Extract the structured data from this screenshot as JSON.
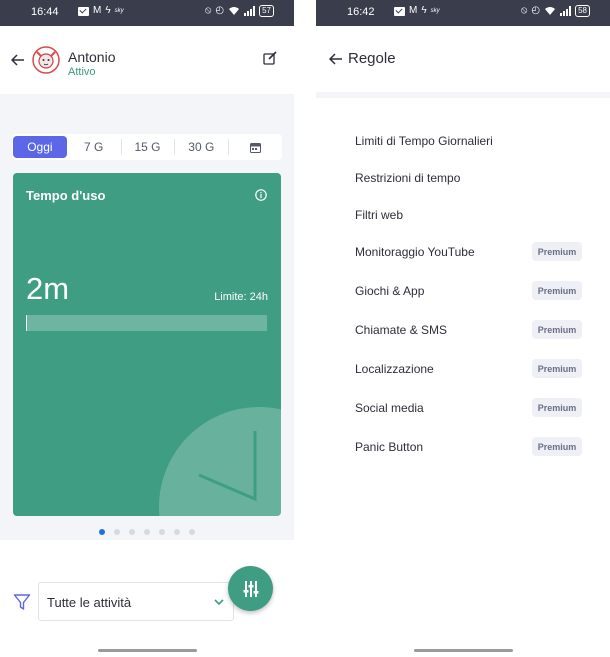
{
  "left": {
    "status_bar": {
      "time": "16:44",
      "battery": "57",
      "notif_text": "sky"
    },
    "header": {
      "child_name": "Antonio",
      "child_status": "Attivo"
    },
    "period_tabs": [
      {
        "label": "Oggi",
        "active": true
      },
      {
        "label": "7 G",
        "active": false
      },
      {
        "label": "15 G",
        "active": false
      },
      {
        "label": "30 G",
        "active": false
      },
      {
        "label": "calendar-icon",
        "active": false
      }
    ],
    "usage_card": {
      "title": "Tempo d'uso",
      "value": "2m",
      "limit": "Limite: 24h",
      "progress_fraction": 0.0014,
      "color": "#3e9d82"
    },
    "page_dots": {
      "count": 7,
      "active_index": 0
    },
    "filter": {
      "selected": "Tutte le attività"
    },
    "accent_color": "#5b67e6"
  },
  "right": {
    "status_bar": {
      "time": "16:42",
      "battery": "58",
      "notif_text": "sky"
    },
    "header": {
      "title": "Regole"
    },
    "rules": [
      {
        "label": "Limiti di Tempo Giornalieri",
        "premium": ""
      },
      {
        "label": "Restrizioni di tempo",
        "premium": ""
      },
      {
        "label": "Filtri web",
        "premium": ""
      },
      {
        "label": "Monitoraggio YouTube",
        "premium": "Premium"
      },
      {
        "label": "Giochi & App",
        "premium": "Premium"
      },
      {
        "label": "Chiamate & SMS",
        "premium": "Premium"
      },
      {
        "label": "Localizzazione",
        "premium": "Premium"
      },
      {
        "label": "Social media",
        "premium": "Premium"
      },
      {
        "label": "Panic Button",
        "premium": "Premium"
      }
    ]
  }
}
